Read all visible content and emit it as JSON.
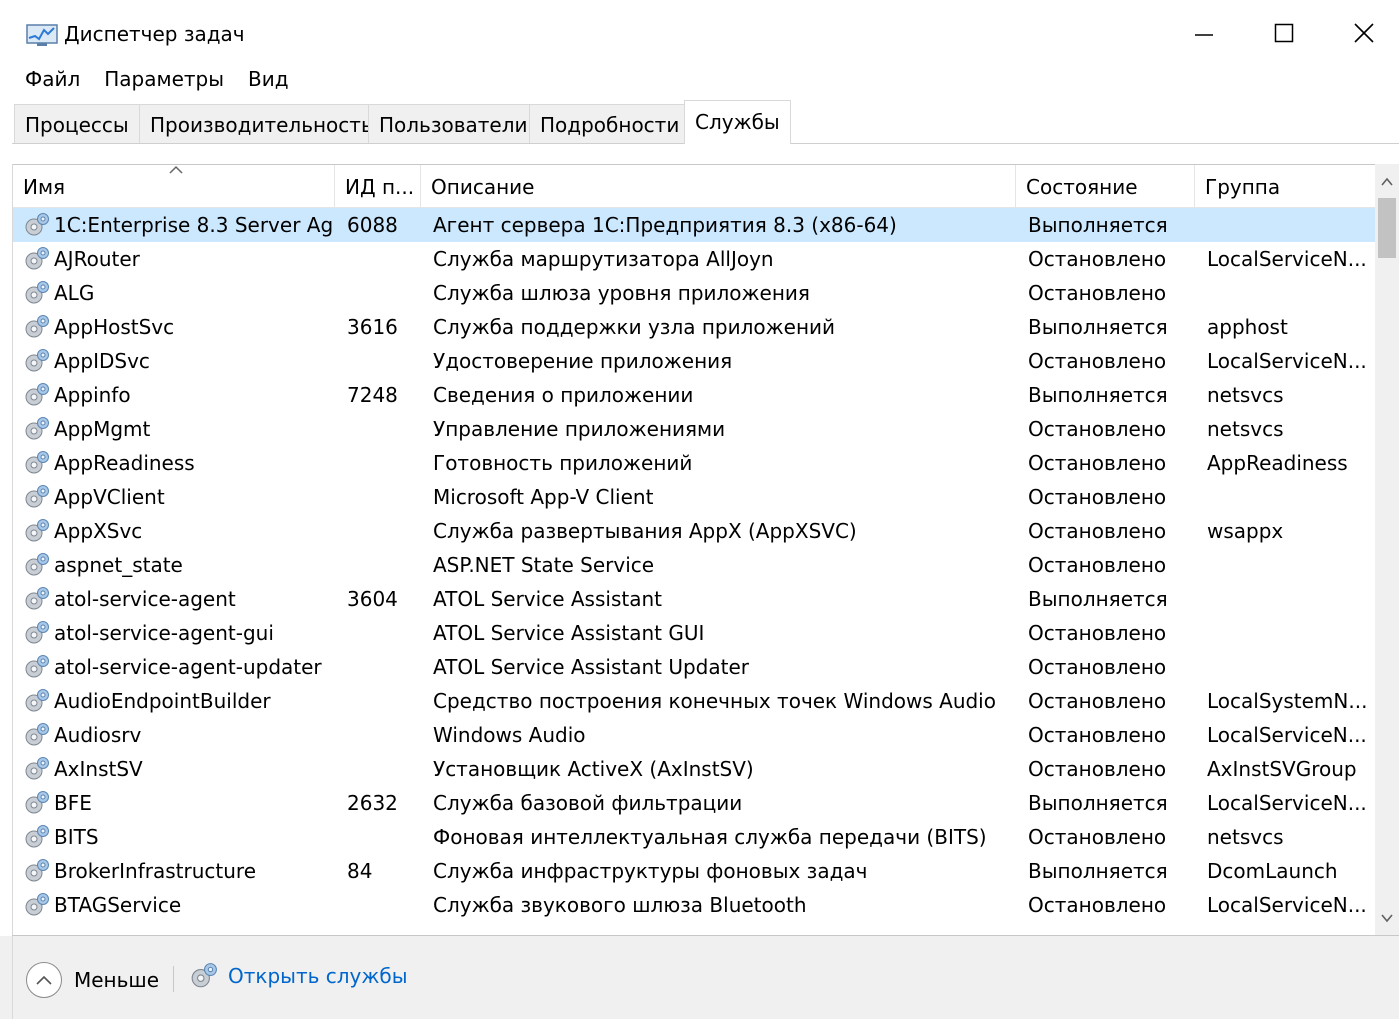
{
  "window": {
    "title": "Диспетчер задач",
    "icon": "task-manager-icon",
    "controls": [
      "minimize-icon",
      "maximize-icon",
      "close-icon"
    ]
  },
  "menu": [
    "Файл",
    "Параметры",
    "Вид"
  ],
  "tabs": [
    {
      "label": "Процессы",
      "active": false
    },
    {
      "label": "Производительность",
      "active": false
    },
    {
      "label": "Пользователи",
      "active": false
    },
    {
      "label": "Подробности",
      "active": false
    },
    {
      "label": "Службы",
      "active": true
    }
  ],
  "table": {
    "columns": [
      "Имя",
      "ИД п...",
      "Описание",
      "Состояние",
      "Группа"
    ],
    "sort_column": "Имя",
    "row_icon": "service-gear-icon",
    "rows": [
      {
        "name": "1C:Enterprise 8.3 Server Ag...",
        "pid": "6088",
        "desc": "Агент сервера 1С:Предприятия 8.3 (x86-64)",
        "state": "Выполняется",
        "group": "",
        "selected": true
      },
      {
        "name": "AJRouter",
        "pid": "",
        "desc": "Служба маршрутизатора AllJoyn",
        "state": "Остановлено",
        "group": "LocalServiceN..."
      },
      {
        "name": "ALG",
        "pid": "",
        "desc": "Служба шлюза уровня приложения",
        "state": "Остановлено",
        "group": ""
      },
      {
        "name": "AppHostSvc",
        "pid": "3616",
        "desc": "Служба поддержки узла приложений",
        "state": "Выполняется",
        "group": "apphost"
      },
      {
        "name": "AppIDSvc",
        "pid": "",
        "desc": "Удостоверение приложения",
        "state": "Остановлено",
        "group": "LocalServiceN..."
      },
      {
        "name": "Appinfo",
        "pid": "7248",
        "desc": "Сведения о приложении",
        "state": "Выполняется",
        "group": "netsvcs"
      },
      {
        "name": "AppMgmt",
        "pid": "",
        "desc": "Управление приложениями",
        "state": "Остановлено",
        "group": "netsvcs"
      },
      {
        "name": "AppReadiness",
        "pid": "",
        "desc": "Готовность приложений",
        "state": "Остановлено",
        "group": "AppReadiness"
      },
      {
        "name": "AppVClient",
        "pid": "",
        "desc": "Microsoft App-V Client",
        "state": "Остановлено",
        "group": ""
      },
      {
        "name": "AppXSvc",
        "pid": "",
        "desc": "Служба развертывания AppX (AppXSVC)",
        "state": "Остановлено",
        "group": "wsappx"
      },
      {
        "name": "aspnet_state",
        "pid": "",
        "desc": "ASP.NET State Service",
        "state": "Остановлено",
        "group": ""
      },
      {
        "name": "atol-service-agent",
        "pid": "3604",
        "desc": "ATOL Service Assistant",
        "state": "Выполняется",
        "group": ""
      },
      {
        "name": "atol-service-agent-gui",
        "pid": "",
        "desc": "ATOL Service Assistant GUI",
        "state": "Остановлено",
        "group": ""
      },
      {
        "name": "atol-service-agent-updater",
        "pid": "",
        "desc": "ATOL Service Assistant Updater",
        "state": "Остановлено",
        "group": ""
      },
      {
        "name": "AudioEndpointBuilder",
        "pid": "",
        "desc": "Средство построения конечных точек Windows Audio",
        "state": "Остановлено",
        "group": "LocalSystemN..."
      },
      {
        "name": "Audiosrv",
        "pid": "",
        "desc": "Windows Audio",
        "state": "Остановлено",
        "group": "LocalServiceN..."
      },
      {
        "name": "AxInstSV",
        "pid": "",
        "desc": "Установщик ActiveX (AxInstSV)",
        "state": "Остановлено",
        "group": "AxInstSVGroup"
      },
      {
        "name": "BFE",
        "pid": "2632",
        "desc": "Служба базовой фильтрации",
        "state": "Выполняется",
        "group": "LocalServiceN..."
      },
      {
        "name": "BITS",
        "pid": "",
        "desc": "Фоновая интеллектуальная служба передачи (BITS)",
        "state": "Остановлено",
        "group": "netsvcs"
      },
      {
        "name": "BrokerInfrastructure",
        "pid": "84",
        "desc": "Служба инфраструктуры фоновых задач",
        "state": "Выполняется",
        "group": "DcomLaunch"
      },
      {
        "name": "BTAGService",
        "pid": "",
        "desc": "Служба звукового шлюза Bluetooth",
        "state": "Остановлено",
        "group": "LocalServiceN..."
      }
    ]
  },
  "footer": {
    "less_label": "Меньше",
    "open_services_label": "Открыть службы",
    "link_color": "#0066cc"
  },
  "colors": {
    "selected_row": "#cce8ff",
    "footer_bg": "#f0f0f0"
  }
}
